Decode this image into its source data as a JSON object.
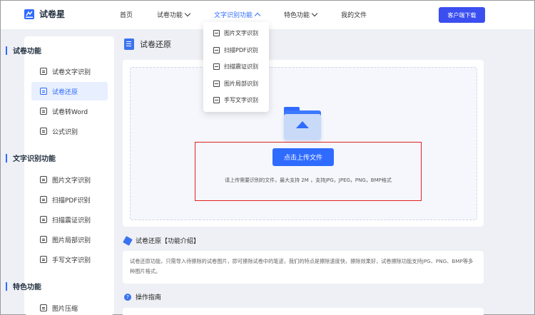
{
  "brand": {
    "name": "试卷星",
    "accent": "#2f6bff"
  },
  "header": {
    "nav": [
      {
        "label": "首页",
        "has_dropdown": false,
        "active": false
      },
      {
        "label": "试卷功能",
        "has_dropdown": true,
        "active": false
      },
      {
        "label": "文字识别功能",
        "has_dropdown": true,
        "active": true
      },
      {
        "label": "特色功能",
        "has_dropdown": true,
        "active": false
      },
      {
        "label": "我的文件",
        "has_dropdown": false,
        "active": false
      }
    ],
    "download_label": "客户端下载"
  },
  "dropdown": {
    "items": [
      {
        "label": "图片文字识别",
        "icon": "image-text-icon"
      },
      {
        "label": "扫描PDF识别",
        "icon": "scan-pdf-icon"
      },
      {
        "label": "扫描震证识别",
        "icon": "scan-card-icon"
      },
      {
        "label": "图片局部识别",
        "icon": "image-crop-icon"
      },
      {
        "label": "手写文字识别",
        "icon": "handwriting-icon"
      }
    ]
  },
  "sidebar": {
    "sections": [
      {
        "title": "试卷功能",
        "items": [
          {
            "label": "试卷文字识别",
            "active": false
          },
          {
            "label": "试卷还原",
            "active": true
          },
          {
            "label": "试卷转Word",
            "active": false
          },
          {
            "label": "公式识别",
            "active": false
          }
        ]
      },
      {
        "title": "文字识别功能",
        "items": [
          {
            "label": "图片文字识别",
            "active": false
          },
          {
            "label": "扫描PDF识别",
            "active": false
          },
          {
            "label": "扫描震证识别",
            "active": false
          },
          {
            "label": "图片局部识别",
            "active": false
          },
          {
            "label": "手写文字识别",
            "active": false
          }
        ]
      },
      {
        "title": "特色功能",
        "items": [
          {
            "label": "图片压缩",
            "active": false
          }
        ]
      }
    ]
  },
  "main": {
    "title": "试卷还原",
    "upload_button": "点击上传文件",
    "upload_hint": "请上传需要识别的文件，最大支持 2M ，支持JPG，JPEG，PNG，BMP格式",
    "intro_title": "试卷还原【功能介绍】",
    "intro_text": "试卷还原功能，只需导入待擦除的试卷图片，即可擦除试卷中的笔迹，我们的特点是擦除速度快，擦除效果好，试卷擦除功能支持JPG、PNG、BMP等多种图片格式。",
    "guide_title": "操作指南"
  }
}
